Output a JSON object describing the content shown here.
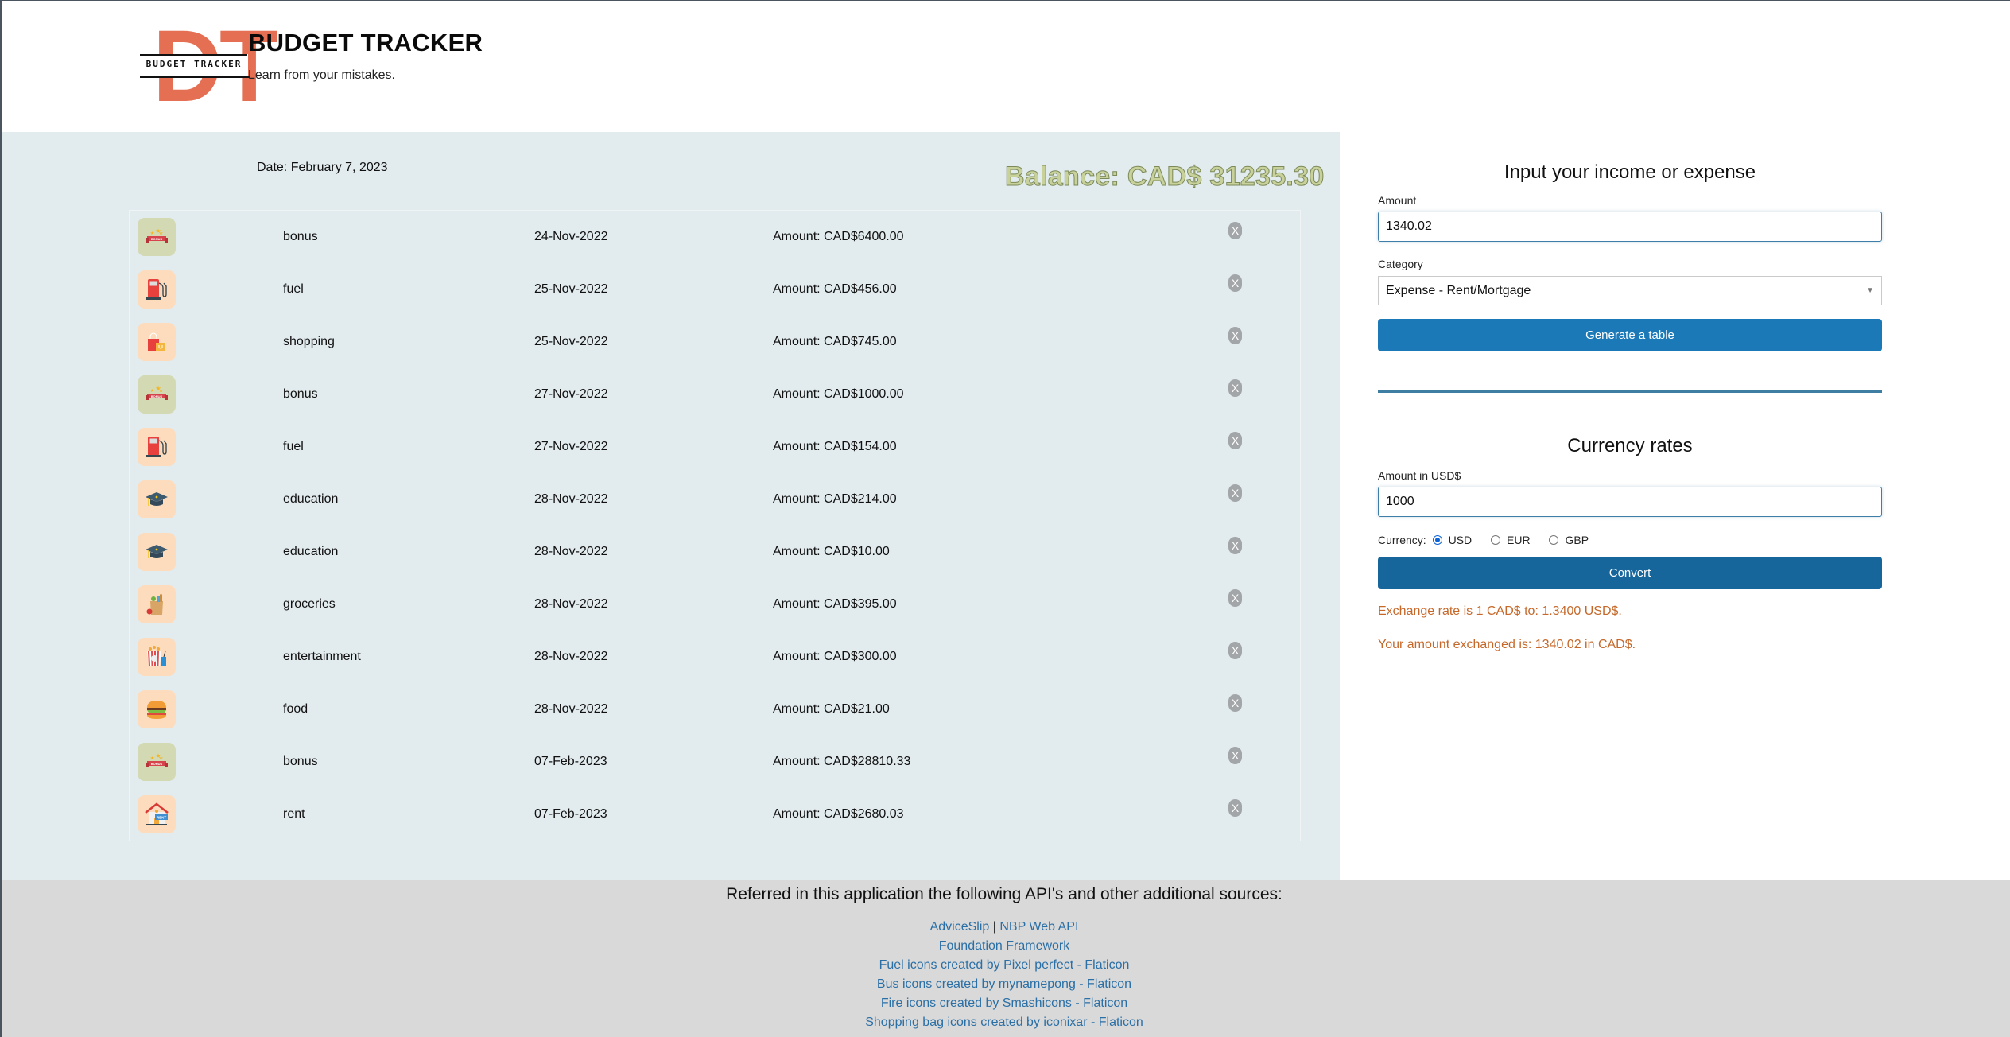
{
  "header": {
    "logo_letters": "DT",
    "logo_caption": "BUDGET TRACKER",
    "title": "BUDGET TRACKER",
    "subtitle": "Learn from your mistakes."
  },
  "main": {
    "date": "Date: February 7, 2023",
    "balance": "Balance: CAD$ 31235.30",
    "transactions": [
      {
        "icon": "bonus-icon",
        "category": "bonus",
        "date": "24-Nov-2022",
        "amount": "Amount: CAD$6400.00",
        "delete_label": "X"
      },
      {
        "icon": "fuel-icon",
        "category": "fuel",
        "date": "25-Nov-2022",
        "amount": "Amount: CAD$456.00",
        "delete_label": "X"
      },
      {
        "icon": "shopping-icon",
        "category": "shopping",
        "date": "25-Nov-2022",
        "amount": "Amount: CAD$745.00",
        "delete_label": "X"
      },
      {
        "icon": "bonus-icon",
        "category": "bonus",
        "date": "27-Nov-2022",
        "amount": "Amount: CAD$1000.00",
        "delete_label": "X"
      },
      {
        "icon": "fuel-icon",
        "category": "fuel",
        "date": "27-Nov-2022",
        "amount": "Amount: CAD$154.00",
        "delete_label": "X"
      },
      {
        "icon": "education-icon",
        "category": "education",
        "date": "28-Nov-2022",
        "amount": "Amount: CAD$214.00",
        "delete_label": "X"
      },
      {
        "icon": "education-icon",
        "category": "education",
        "date": "28-Nov-2022",
        "amount": "Amount: CAD$10.00",
        "delete_label": "X"
      },
      {
        "icon": "groceries-icon",
        "category": "groceries",
        "date": "28-Nov-2022",
        "amount": "Amount: CAD$395.00",
        "delete_label": "X"
      },
      {
        "icon": "entertainment-icon",
        "category": "entertainment",
        "date": "28-Nov-2022",
        "amount": "Amount: CAD$300.00",
        "delete_label": "X"
      },
      {
        "icon": "food-icon",
        "category": "food",
        "date": "28-Nov-2022",
        "amount": "Amount: CAD$21.00",
        "delete_label": "X"
      },
      {
        "icon": "bonus-icon",
        "category": "bonus",
        "date": "07-Feb-2023",
        "amount": "Amount: CAD$28810.33",
        "delete_label": "X"
      },
      {
        "icon": "rent-icon",
        "category": "rent",
        "date": "07-Feb-2023",
        "amount": "Amount: CAD$2680.03",
        "delete_label": "X"
      }
    ]
  },
  "entry_form": {
    "title": "Input your income or expense",
    "amount_label": "Amount",
    "amount_value": "1340.02",
    "category_label": "Category",
    "category_selected": "Expense - Rent/Mortgage",
    "submit_label": "Generate a table"
  },
  "currency_form": {
    "title": "Currency rates",
    "amount_label": "Amount in USD$",
    "amount_value": "1000",
    "currency_label": "Currency:",
    "options": [
      {
        "label": "USD",
        "checked": true
      },
      {
        "label": "EUR",
        "checked": false
      },
      {
        "label": "GBP",
        "checked": false
      }
    ],
    "convert_label": "Convert",
    "exchange_rate_text": "Exchange rate is 1 CAD$ to: 1.3400 USD$.",
    "exchanged_text": "Your amount exchanged is: 1340.02 in CAD$."
  },
  "footer": {
    "title": "Referred in this application the following API's and other additional sources:",
    "api_links": [
      "AdviceSlip",
      "NBP Web API"
    ],
    "separator": "|",
    "links": [
      "Foundation Framework",
      "Fuel icons created by Pixel perfect - Flaticon",
      "Bus icons created by mynamepong - Flaticon",
      "Fire icons created by Smashicons - Flaticon",
      "Shopping bag icons created by iconixar - Flaticon"
    ]
  },
  "colors": {
    "accent_blue": "#1b79b8",
    "convert_blue": "#16659b",
    "logo_orange": "#e56f53",
    "balance_green": "#c8d19a",
    "message_orange": "#c6682a",
    "panel_bg": "#e2ebee",
    "footer_bg": "#d9d9d9"
  }
}
